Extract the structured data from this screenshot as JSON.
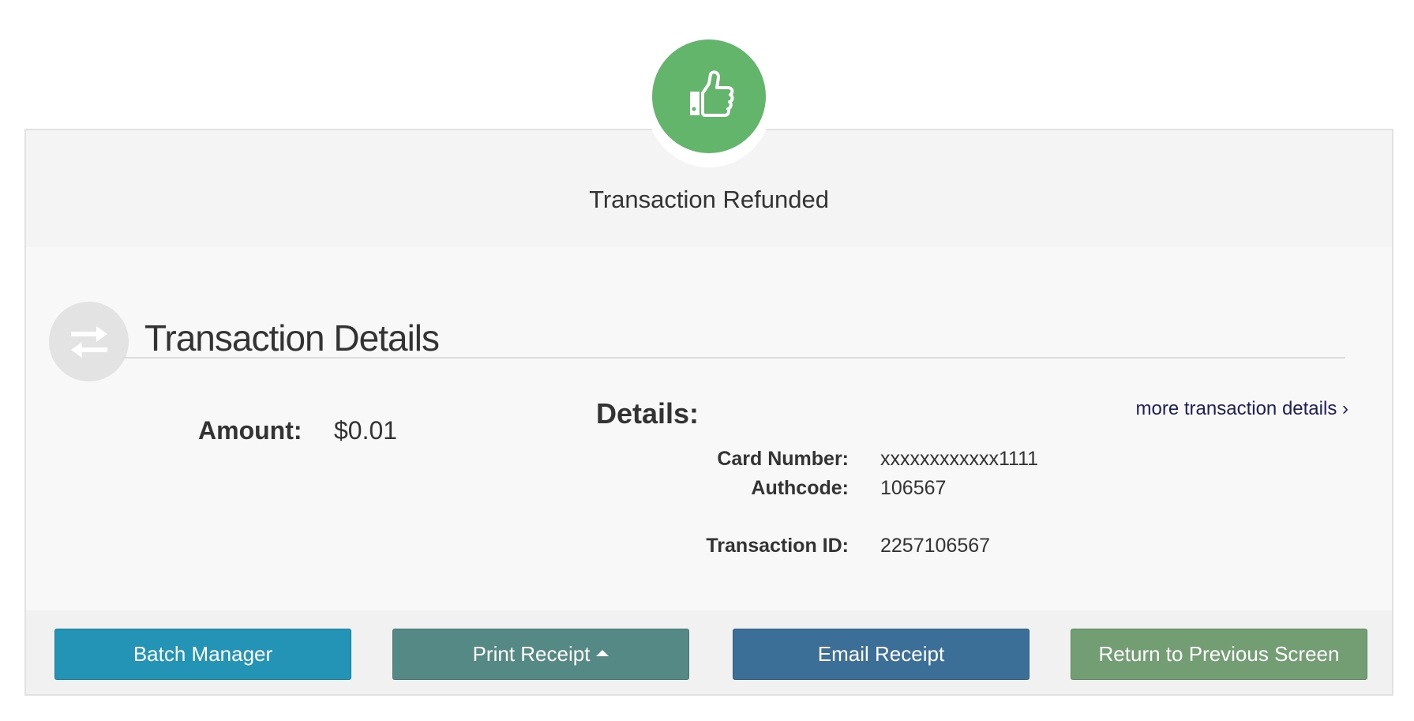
{
  "status": {
    "title": "Transaction Refunded",
    "icon": "thumbs-up-icon",
    "color": "#62b56b"
  },
  "section": {
    "title": "Transaction Details",
    "icon": "exchange-arrows-icon"
  },
  "amount": {
    "label": "Amount:",
    "value": "$0.01"
  },
  "details": {
    "label": "Details:",
    "more_link": "more transaction details",
    "rows": [
      {
        "label": "Card Number:",
        "value": "xxxxxxxxxxxx1111"
      },
      {
        "label": "Authcode:",
        "value": "106567"
      },
      {
        "label": "Transaction ID:",
        "value": "2257106567"
      }
    ]
  },
  "buttons": {
    "batch_manager": {
      "label": "Batch Manager",
      "color": "#2394b5"
    },
    "print_receipt": {
      "label": "Print Receipt",
      "color": "#558985"
    },
    "email_receipt": {
      "label": "Email Receipt",
      "color": "#3c6f97"
    },
    "return_previous": {
      "label": "Return to Previous Screen",
      "color": "#739e74"
    }
  }
}
